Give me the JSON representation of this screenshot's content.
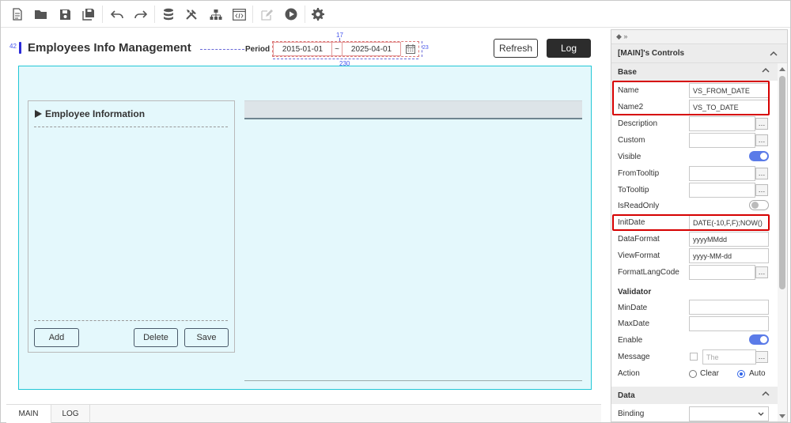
{
  "toolbar": {
    "icons": [
      "new-file-icon",
      "open-folder-icon",
      "save-icon",
      "save-all-icon",
      "undo-icon",
      "redo-icon",
      "database-icon",
      "tools-icon",
      "tree-icon",
      "code-icon",
      "edit-icon",
      "play-icon",
      "gear-icon"
    ]
  },
  "page": {
    "title": "Employees Info Management",
    "period_label": "Period",
    "from_date": "2015-01-01",
    "to_date": "2025-04-01",
    "separator": "~",
    "anno_left": "42",
    "anno_top": "17",
    "anno_right": "23",
    "anno_bottom": "230"
  },
  "buttons": {
    "refresh": "Refresh",
    "log": "Log"
  },
  "panel": {
    "title": "Employee Information",
    "add": "Add",
    "delete": "Delete",
    "save": "Save"
  },
  "tabs": [
    {
      "label": "MAIN"
    },
    {
      "label": "LOG"
    }
  ],
  "props": {
    "top_icons": "◆ »",
    "title": "[MAIN]'s Controls",
    "sections": {
      "base": "Base",
      "validator": "Validator",
      "data": "Data"
    },
    "labels": {
      "name": "Name",
      "name2": "Name2",
      "description": "Description",
      "custom": "Custom",
      "visible": "Visible",
      "fromtooltip": "FromTooltip",
      "totooltip": "ToTooltip",
      "isreadonly": "IsReadOnly",
      "initdate": "InitDate",
      "dataformat": "DataFormat",
      "viewformat": "ViewFormat",
      "formatlangcode": "FormatLangCode",
      "mindate": "MinDate",
      "maxdate": "MaxDate",
      "enable": "Enable",
      "message": "Message",
      "action": "Action",
      "binding": "Binding"
    },
    "values": {
      "name": "VS_FROM_DATE",
      "name2": "VS_TO_DATE",
      "initdate": "DATE(-10,F,F);NOW()",
      "dataformat": "yyyyMMdd",
      "viewformat": "yyyy-MM-dd",
      "message_placeholder": "The"
    },
    "action_options": {
      "clear": "Clear",
      "auto": "Auto"
    },
    "ellipsis": "…"
  }
}
